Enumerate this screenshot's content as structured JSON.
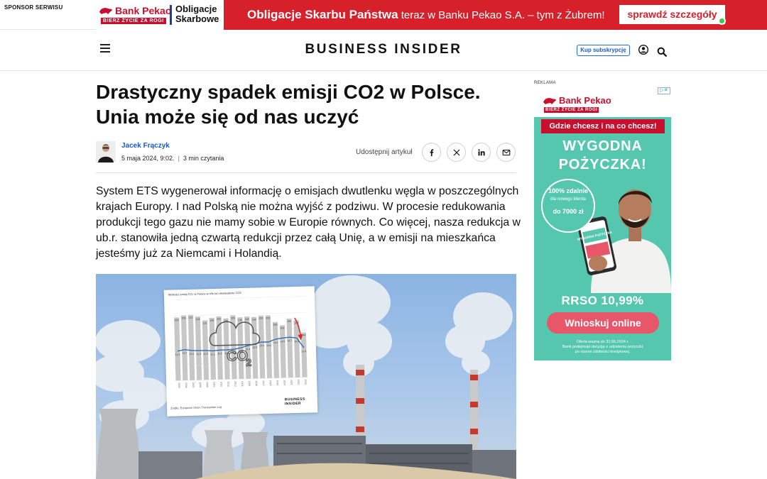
{
  "sponsor": {
    "label": "SPONSOR SERWISU",
    "bank_name": "Bank Pekao",
    "bank_tagline": "BIERZ ŻYCIE ZA ROGI",
    "product_line1": "Obligacje",
    "product_line2": "Skarbowe",
    "headline_bold": "Obligacje Skarbu Państwa",
    "headline_rest": " teraz w Banku Pekao S.A. – tym z Żubrem!",
    "cta": "sprawdź szczegóły",
    "color_red": "#d6202a"
  },
  "header": {
    "brand": "BUSINESS INSIDER",
    "subscribe": "Kup subskrypcję",
    "menu_icon": "hamburger-icon",
    "user_icon": "user-icon",
    "search_icon": "search-icon"
  },
  "article": {
    "headline": "Drastyczny spadek emisji CO2 w Polsce. Unia może się od nas uczyć",
    "author": "Jacek Frączyk",
    "date": "5 maja 2024, 9:02.",
    "read_time": "3 min czytania",
    "share_label": "Udostępnij artykuł",
    "share_buttons": [
      {
        "name": "facebook",
        "label": "f"
      },
      {
        "name": "x",
        "label": "𝕏"
      },
      {
        "name": "linkedin",
        "label": "in"
      },
      {
        "name": "email",
        "label": "email"
      }
    ],
    "lead": "System ETS wygenerował informację o emisjach dwutlenku węgla w poszczególnych krajach Europy. I nad Polską nie można wyjść z podziwu. W procesie redukowania produkcji tego gazu nie mamy sobie w Europie równych. Co więcej, nasza redukcja w ub.r. stanowiła jedną czwartą redukcji przez całą Unię, a w emisji na mieszkańca jesteśmy już za Niemcami i Holandią.",
    "accent_color": "#1d57c7"
  },
  "hero_chart": {
    "title": "Wartości emisji CO₂ w Polsce w mln ton ekwiwalentu CO2",
    "source": "Źródło: European Union Transaction Log",
    "brand_line1": "BUSINESS",
    "brand_line2": "INSIDER",
    "co2_label": "CO",
    "co2_sub": "2"
  },
  "chart_data": {
    "type": "bar",
    "categories": [
      "2005",
      "2006",
      "2007",
      "2008",
      "2009",
      "2010",
      "2011",
      "2012",
      "2013",
      "2014",
      "2015",
      "2016",
      "2017",
      "2018",
      "2019",
      "2020",
      "2021",
      "2022",
      "2023"
    ],
    "series": [
      {
        "values": [
          203,
          209,
          210,
          204,
          191,
          199,
          203,
          196,
          205,
          198,
          200,
          198,
          202,
          202,
          180,
          169,
          190,
          184,
          144
        ]
      },
      {
        "values": [
          11.3,
          11.7,
          11.4,
          11.3,
          11.3,
          11.1,
          11.3,
          11.3,
          11.4,
          11.8,
          12.4,
          12.9,
          13.4,
          13.4,
          14.2,
          14.5,
          14.7,
          14.4,
          11.3
        ]
      }
    ],
    "ylim": [
      0,
      260
    ]
  },
  "ad": {
    "label": "REKLAMA",
    "bank_name": "Bank Pekao",
    "bank_tagline": "BIERZ ŻYCIE ZA ROGI",
    "tagline": "Gdzie chcesz i na co chcesz!",
    "headline_line1": "WYGODNA",
    "headline_line2": "POŻYCZKA!",
    "circle_line1": "100% zdalnie",
    "circle_line2": "dla nowego klienta",
    "circle_line3": "do 7000 zł",
    "phone_text": "WYGODNA POŻYCZKA",
    "rrso": "RRSO 10,99%",
    "cta": "Wnioskuj online",
    "fine_line1": "Oferta ważna do 31.05.2024 r.",
    "fine_line2": "Bank podejmuje decyzję o udzieleniu pożyczki",
    "fine_line3": "po ocenie zdolności kredytowej.",
    "choice_label": "▷✕",
    "bg_color": "#55c7ae"
  }
}
